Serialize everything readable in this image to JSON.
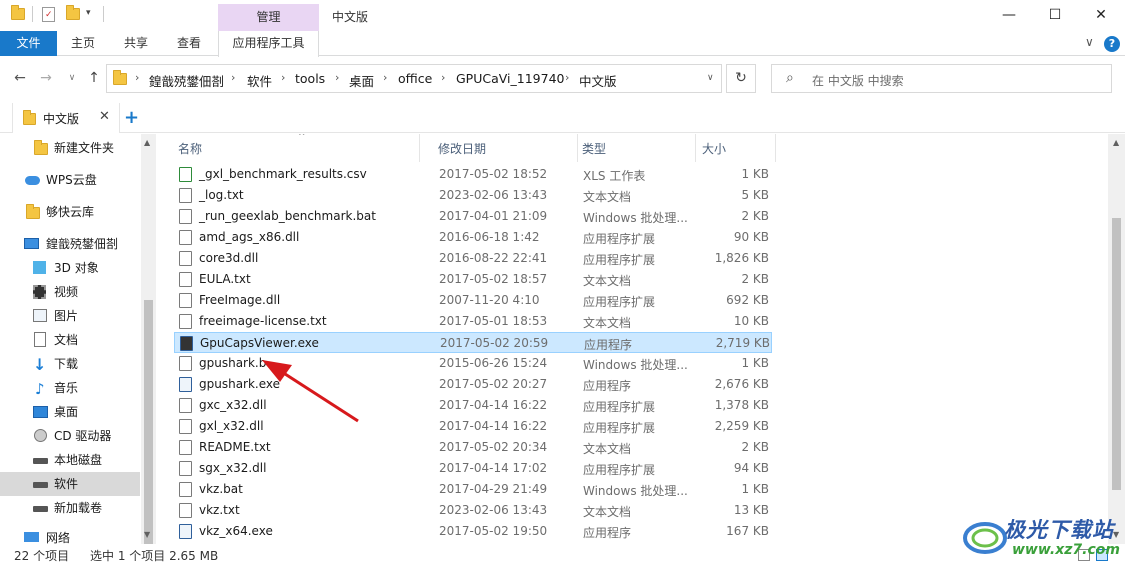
{
  "title_bar": {
    "context_tab": "管理",
    "window_title": "中文版",
    "minimize": "—",
    "maximize": "☐",
    "close": "✕"
  },
  "ribbon": {
    "tabs": [
      "文件",
      "主页",
      "共享",
      "查看",
      "应用程序工具"
    ],
    "collapse": "∨",
    "help": "?"
  },
  "address": {
    "breadcrumbs": [
      "鍠戠殑鐢佃剳",
      "软件",
      "tools",
      "桌面",
      "office",
      "GPUCaVi_119740",
      "中文版"
    ],
    "search_placeholder": "在 中文版 中搜索"
  },
  "tab_bar": {
    "tab_label": "中文版",
    "close": "✕",
    "add": "+"
  },
  "sidebar": {
    "items": [
      {
        "label": "新建文件夹",
        "icon": "folder-icon"
      },
      {
        "label": "WPS云盘",
        "icon": "cloud-icon"
      },
      {
        "label": "够快云库",
        "icon": "folder-icon"
      },
      {
        "label": "鍠戠殑鐢佃剳",
        "icon": "computer-icon"
      },
      {
        "label": "3D 对象",
        "icon": "cube-icon"
      },
      {
        "label": "视频",
        "icon": "video-icon"
      },
      {
        "label": "图片",
        "icon": "picture-icon"
      },
      {
        "label": "文档",
        "icon": "document-icon"
      },
      {
        "label": "下载",
        "icon": "download-icon"
      },
      {
        "label": "音乐",
        "icon": "music-icon"
      },
      {
        "label": "桌面",
        "icon": "desktop-icon"
      },
      {
        "label": "CD 驱动器",
        "icon": "cd-drive-icon"
      },
      {
        "label": "本地磁盘",
        "icon": "disk-icon"
      },
      {
        "label": "软件",
        "icon": "disk-icon"
      },
      {
        "label": "新加载卷",
        "icon": "disk-icon"
      },
      {
        "label": "网络",
        "icon": "network-icon"
      }
    ]
  },
  "file_list": {
    "columns": [
      "名称",
      "修改日期",
      "类型",
      "大小"
    ],
    "rows": [
      {
        "name": "_gxl_benchmark_results.csv",
        "date": "2017-05-02 18:52",
        "type": "XLS 工作表",
        "size": "1 KB"
      },
      {
        "name": "_log.txt",
        "date": "2023-02-06 13:43",
        "type": "文本文档",
        "size": "5 KB"
      },
      {
        "name": "_run_geexlab_benchmark.bat",
        "date": "2017-04-01 21:09",
        "type": "Windows 批处理...",
        "size": "2 KB"
      },
      {
        "name": "amd_ags_x86.dll",
        "date": "2016-06-18 1:42",
        "type": "应用程序扩展",
        "size": "90 KB"
      },
      {
        "name": "core3d.dll",
        "date": "2016-08-22 22:41",
        "type": "应用程序扩展",
        "size": "1,826 KB"
      },
      {
        "name": "EULA.txt",
        "date": "2017-05-02 18:57",
        "type": "文本文档",
        "size": "2 KB"
      },
      {
        "name": "FreeImage.dll",
        "date": "2007-11-20 4:10",
        "type": "应用程序扩展",
        "size": "692 KB"
      },
      {
        "name": "freeimage-license.txt",
        "date": "2017-05-01 18:53",
        "type": "文本文档",
        "size": "10 KB"
      },
      {
        "name": "GpuCapsViewer.exe",
        "date": "2017-05-02 20:59",
        "type": "应用程序",
        "size": "2,719 KB"
      },
      {
        "name": "gpushark.b",
        "date": "2015-06-26 15:24",
        "type": "Windows 批处理...",
        "size": "1 KB"
      },
      {
        "name": "gpushark.exe",
        "date": "2017-05-02 20:27",
        "type": "应用程序",
        "size": "2,676 KB"
      },
      {
        "name": "gxc_x32.dll",
        "date": "2017-04-14 16:22",
        "type": "应用程序扩展",
        "size": "1,378 KB"
      },
      {
        "name": "gxl_x32.dll",
        "date": "2017-04-14 16:22",
        "type": "应用程序扩展",
        "size": "2,259 KB"
      },
      {
        "name": "README.txt",
        "date": "2017-05-02 20:34",
        "type": "文本文档",
        "size": "2 KB"
      },
      {
        "name": "sgx_x32.dll",
        "date": "2017-04-14 17:02",
        "type": "应用程序扩展",
        "size": "94 KB"
      },
      {
        "name": "vkz.bat",
        "date": "2017-04-29 21:49",
        "type": "Windows 批处理...",
        "size": "1 KB"
      },
      {
        "name": "vkz.txt",
        "date": "2023-02-06 13:43",
        "type": "文本文档",
        "size": "13 KB"
      },
      {
        "name": "vkz_x64.exe",
        "date": "2017-05-02 19:50",
        "type": "应用程序",
        "size": "167 KB"
      }
    ],
    "selected_index": 8
  },
  "status_bar": {
    "item_count": "22 个项目",
    "selection": "选中 1 个项目  2.65 MB"
  },
  "watermark": {
    "text": "极光下载站",
    "url": "www.xz7.com"
  },
  "colors": {
    "accent": "#1979ca",
    "selection": "#cce8ff",
    "context_tab": "#e9d6f3",
    "arrow": "#d7191c"
  }
}
